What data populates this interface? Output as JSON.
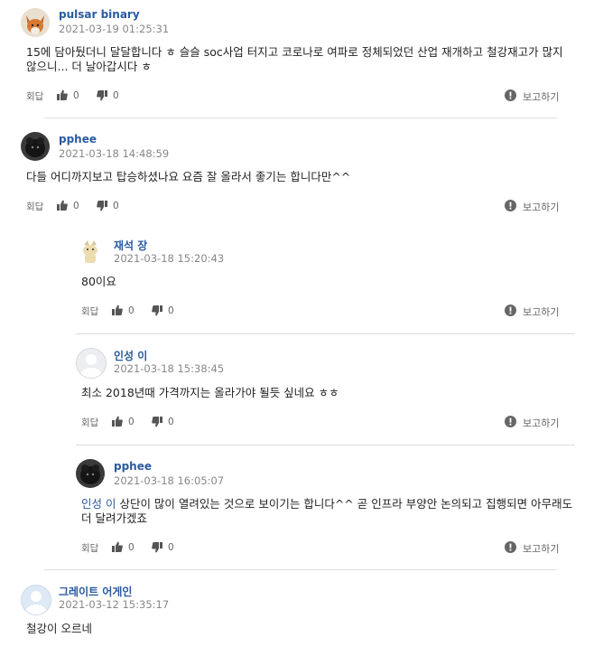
{
  "actions": {
    "reply_label": "회답",
    "report_label": "보고하기"
  },
  "comments": [
    {
      "author": "pulsar binary",
      "date": "2021-03-19 01:25:31",
      "body": "15에 담아뒀더니 달달합니다 ㅎ 슬슬 soc사업 터지고 코로나로 여파로 정체되었던 산업 재개하고 철강재고가 많지 않으니... 더 날아갑시다 ㅎ",
      "likes": "0",
      "dislikes": "0",
      "avatar_icon": "fox-avatar"
    },
    {
      "author": "pphee",
      "date": "2021-03-18 14:48:59",
      "body": "다들 어디까지보고 탑승하셨나요 요즘 잘 올라서 좋기는 합니다만^^",
      "likes": "0",
      "dislikes": "0",
      "avatar_icon": "dark-animal-avatar"
    },
    {
      "author": "재석 장",
      "date": "2021-03-18 15:20:43",
      "body": "80이요",
      "likes": "0",
      "dislikes": "0",
      "avatar_icon": "cartoon-dog-avatar"
    },
    {
      "author": "인성 이",
      "date": "2021-03-18 15:38:45",
      "body": "최소 2018년때 가격까지는 올라가야 될듯 싶네요 ㅎㅎ",
      "likes": "0",
      "dislikes": "0",
      "avatar_icon": "default-user-avatar"
    },
    {
      "author": "pphee",
      "date": "2021-03-18 16:05:07",
      "mention": "인성 이",
      "body": " 상단이 많이 열려있는 것으로 보이기는 합니다^^ 곧 인프라 부양안 논의되고 집행되면 아무래도 더 달려가겠죠",
      "likes": "0",
      "dislikes": "0",
      "avatar_icon": "dark-animal-avatar"
    },
    {
      "author": "그레이트 어게인",
      "date": "2021-03-12 15:35:17",
      "body": "철강이 오르네",
      "avatar_icon": "default-user-avatar"
    }
  ]
}
